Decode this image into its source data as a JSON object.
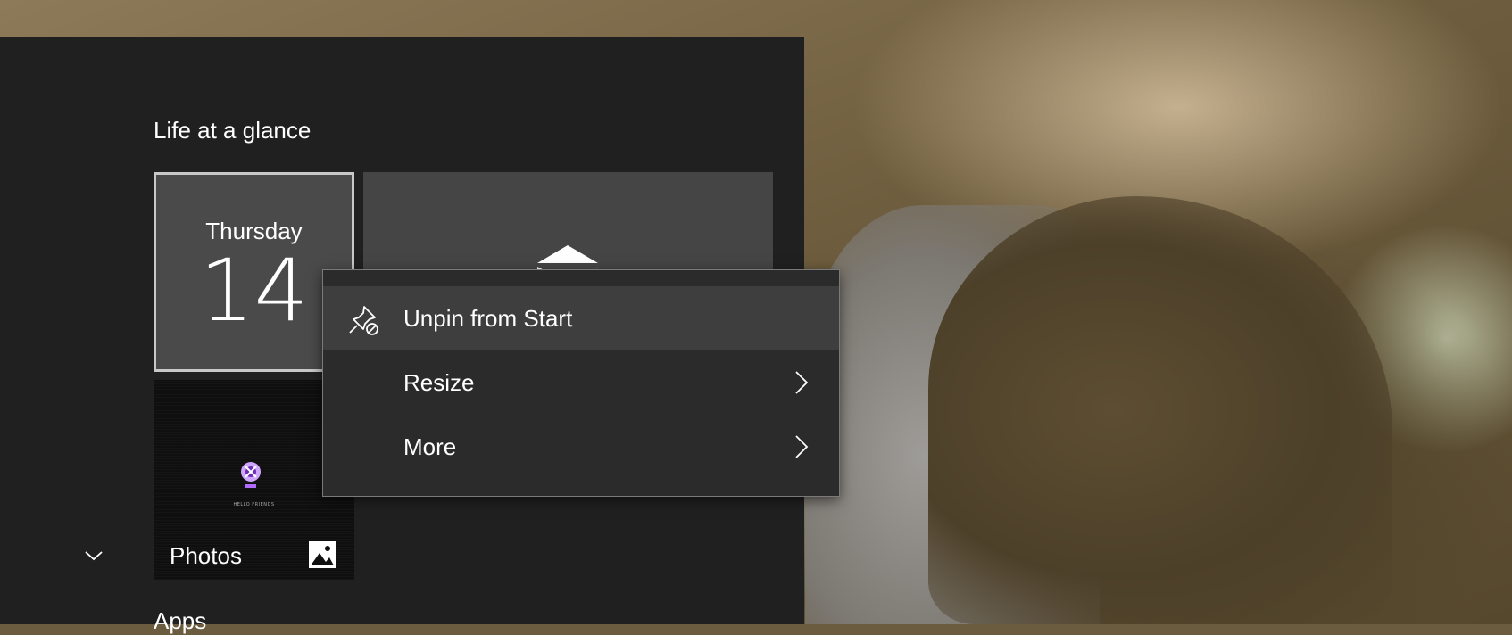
{
  "start": {
    "group_title": "Life at a glance",
    "apps_title": "Apps",
    "tiles": {
      "calendar": {
        "day": "Thursday",
        "date": "14"
      },
      "mail": {
        "icon": "mail-icon"
      },
      "photos": {
        "label": "Photos",
        "icon": "photos-icon",
        "thumbnail_caption": "HELLO FRIENDS"
      }
    }
  },
  "context_menu": {
    "items": [
      {
        "label": "Unpin from Start",
        "icon": "unpin-icon",
        "highlighted": true
      },
      {
        "label": "Resize",
        "icon": "chevron-right-icon"
      },
      {
        "label": "More",
        "icon": "chevron-right-icon"
      }
    ]
  },
  "colors": {
    "panel_bg": "#202020",
    "tile_bg": "#4a4a4a",
    "menu_bg": "#2b2b2b",
    "menu_highlight": "#3e3e3e",
    "text": "#ffffff"
  }
}
